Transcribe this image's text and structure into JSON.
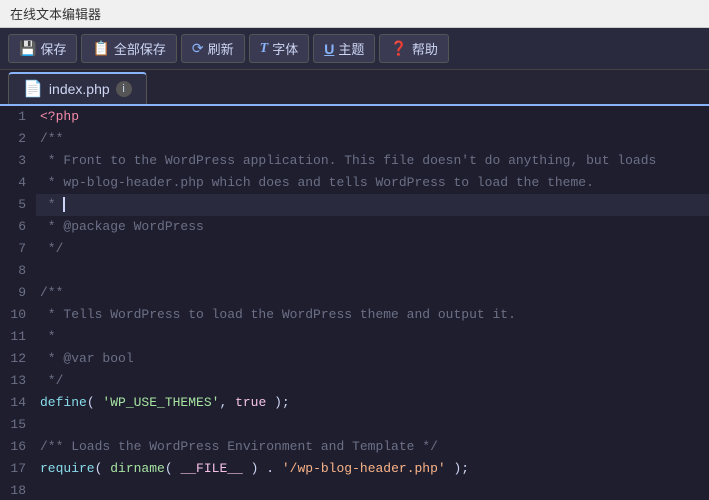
{
  "titleBar": {
    "label": "在线文本编辑器"
  },
  "toolbar": {
    "buttons": [
      {
        "id": "save",
        "icon": "💾",
        "label": "保存"
      },
      {
        "id": "save-all",
        "icon": "📋",
        "label": "全部保存"
      },
      {
        "id": "refresh",
        "icon": "🔄",
        "label": "刷新"
      },
      {
        "id": "font",
        "icon": "T",
        "label": "字体"
      },
      {
        "id": "theme",
        "icon": "U",
        "label": "主题"
      },
      {
        "id": "help",
        "icon": "❓",
        "label": "帮助"
      }
    ]
  },
  "tab": {
    "filename": "index.php",
    "info": "i"
  },
  "lines": [
    {
      "num": 1,
      "content": "php_open"
    },
    {
      "num": 2,
      "content": "comment_start"
    },
    {
      "num": 3,
      "content": "comment_front"
    },
    {
      "num": 4,
      "content": "comment_wp_blog"
    },
    {
      "num": 5,
      "content": "comment_star_cursor"
    },
    {
      "num": 6,
      "content": "comment_package"
    },
    {
      "num": 7,
      "content": "comment_end"
    },
    {
      "num": 8,
      "content": "blank"
    },
    {
      "num": 9,
      "content": "comment_start"
    },
    {
      "num": 10,
      "content": "comment_tells"
    },
    {
      "num": 11,
      "content": "comment_star"
    },
    {
      "num": 12,
      "content": "comment_var"
    },
    {
      "num": 13,
      "content": "comment_end"
    },
    {
      "num": 14,
      "content": "define_line"
    },
    {
      "num": 15,
      "content": "blank"
    },
    {
      "num": 16,
      "content": "comment_loads"
    },
    {
      "num": 17,
      "content": "require_line"
    },
    {
      "num": 18,
      "content": "blank"
    }
  ]
}
